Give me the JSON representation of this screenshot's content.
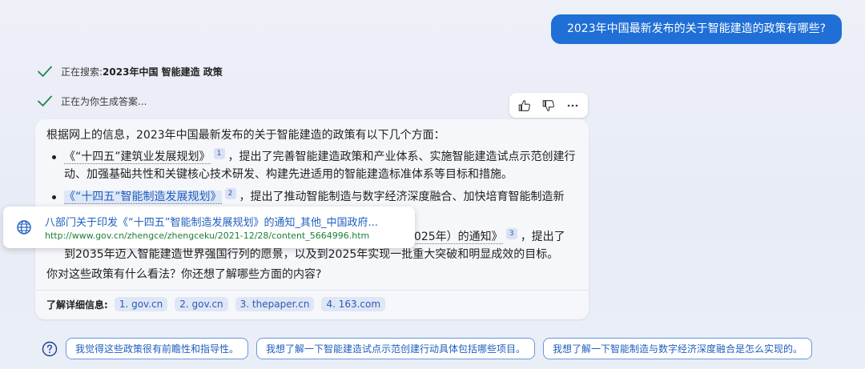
{
  "user_message": "2023年中国最新发布的关于智能建造的政策有哪些?",
  "status": {
    "searching_prefix": "正在搜索: ",
    "searching_query": "2023年中国 智能建造 政策",
    "generating": "正在为你生成答案..."
  },
  "answer": {
    "intro": "根据网上的信息，2023年中国最新发布的关于智能建造的政策有以下几个方面：",
    "bullets": [
      {
        "title": "《“十四五”建筑业发展规划》",
        "ref": "1",
        "text": "，提出了完善智能建造政策和产业体系、实施智能建造试点示范创建行动、加强基础共性和关键核心技术研发、构建先进适用的智能建造标准体系等目标和措施。"
      },
      {
        "title": "《“十四五”智能制造发展规划》",
        "ref": "2",
        "text": "，提出了推动智能制造与数字经济深度融合、加快培育智能制造新"
      },
      {
        "title_suffix": "-2025年）的通知》",
        "ref": "3",
        "text_line1": "，提出了",
        "text_line2": "到2035年迈入智能建造世界强国行列的愿景，以及到2025年实现一批重大突破和明显成效的目标。"
      }
    ],
    "question": "你对这些政策有什么看法？你还想了解哪些方面的内容?",
    "learn_more_label": "了解详细信息:",
    "sources": [
      "1. gov.cn",
      "2. gov.cn",
      "3. thepaper.cn",
      "4. 163.com"
    ]
  },
  "tooltip": {
    "title": "八部门关于印发《“十四五”智能制造发展规划》的通知_其他_中国政府...",
    "url": "http://www.gov.cn/zhengce/zhengceku/2021-12/28/content_5664996.htm"
  },
  "suggestions": [
    "我觉得这些政策很有前瞻性和指导性。",
    "我想了解一下智能建造试点示范创建行动具体包括哪些项目。",
    "我想了解一下智能制造与数字经济深度融合是怎么实现的。"
  ],
  "colors": {
    "accent": "#1f6fd6",
    "check": "#1a8a4a",
    "link": "#1f5fbf",
    "url": "#1a7f37"
  }
}
